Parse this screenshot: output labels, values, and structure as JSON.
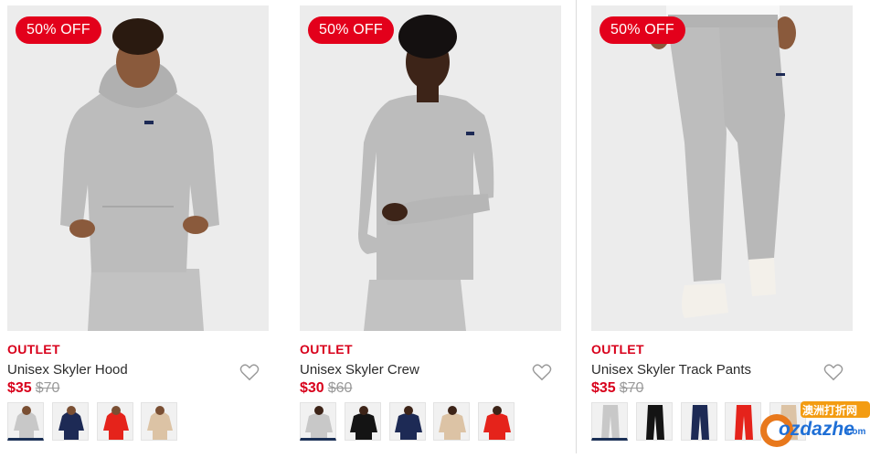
{
  "products": [
    {
      "badge": "50% OFF",
      "tag": "OUTLET",
      "name": "Unisex Skyler Hood",
      "price": "$35",
      "original_price": "$70",
      "type": "hood",
      "swatches": [
        "#c8c8c8",
        "#1d2a55",
        "#e5231b",
        "#dcc3a5"
      ]
    },
    {
      "badge": "50% OFF",
      "tag": "OUTLET",
      "name": "Unisex Skyler Crew",
      "price": "$30",
      "original_price": "$60",
      "type": "crew",
      "swatches": [
        "#c8c8c8",
        "#141414",
        "#1d2a55",
        "#dcc3a5",
        "#e5231b"
      ]
    },
    {
      "badge": "50% OFF",
      "tag": "OUTLET",
      "name": "Unisex Skyler Track Pants",
      "price": "$35",
      "original_price": "$70",
      "type": "pants",
      "swatches": [
        "#c8c8c8",
        "#141414",
        "#1d2a55",
        "#e5231b",
        "#dcc3a5"
      ]
    }
  ],
  "watermark": {
    "text": "ozdazhe",
    "suffix": ".com",
    "badge_text": "澳洲打折网"
  }
}
